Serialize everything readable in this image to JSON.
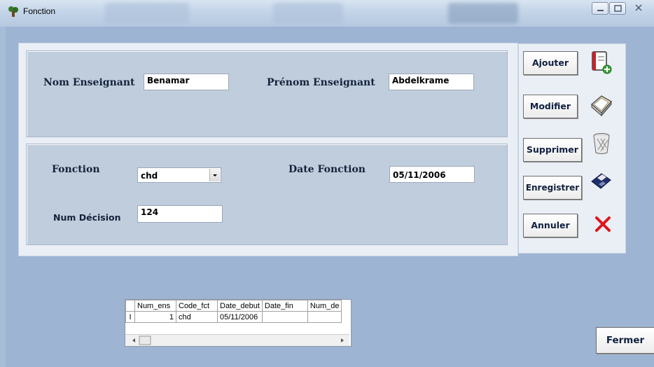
{
  "window": {
    "title": "Fonction"
  },
  "header_fields": {
    "nom_label": "Nom Enseignant",
    "nom_value": "Benamar",
    "prenom_label": "Prénom Enseignant",
    "prenom_value": "Abdelkrame"
  },
  "detail_fields": {
    "fonction_label": "Fonction",
    "fonction_value": "chd",
    "date_label": "Date Fonction",
    "date_value": "05/11/2006",
    "num_label": "Num Décision",
    "num_value": "124"
  },
  "buttons": {
    "ajouter": "Ajouter",
    "modifier": "Modifier",
    "supprimer": "Supprimer",
    "enregistrer": "Enregistrer",
    "annuler": "Annuler",
    "fermer": "Fermer"
  },
  "icons": {
    "ajouter": "add-document-icon",
    "modifier": "edit-papers-icon",
    "supprimer": "trash-bin-icon",
    "enregistrer": "floppy-disk-icon",
    "annuler": "red-x-icon"
  },
  "grid": {
    "columns": [
      "Num_ens",
      "Code_fct",
      "Date_debut",
      "Date_fin",
      "Num_de"
    ],
    "rows": [
      {
        "Num_ens": "1",
        "Code_fct": "chd",
        "Date_debut": "05/11/2006",
        "Date_fin": "",
        "Num_de": ""
      }
    ]
  },
  "colors": {
    "background": "#9db4d2",
    "pane": "#c0cddc",
    "cancel_red": "#e0141a"
  }
}
